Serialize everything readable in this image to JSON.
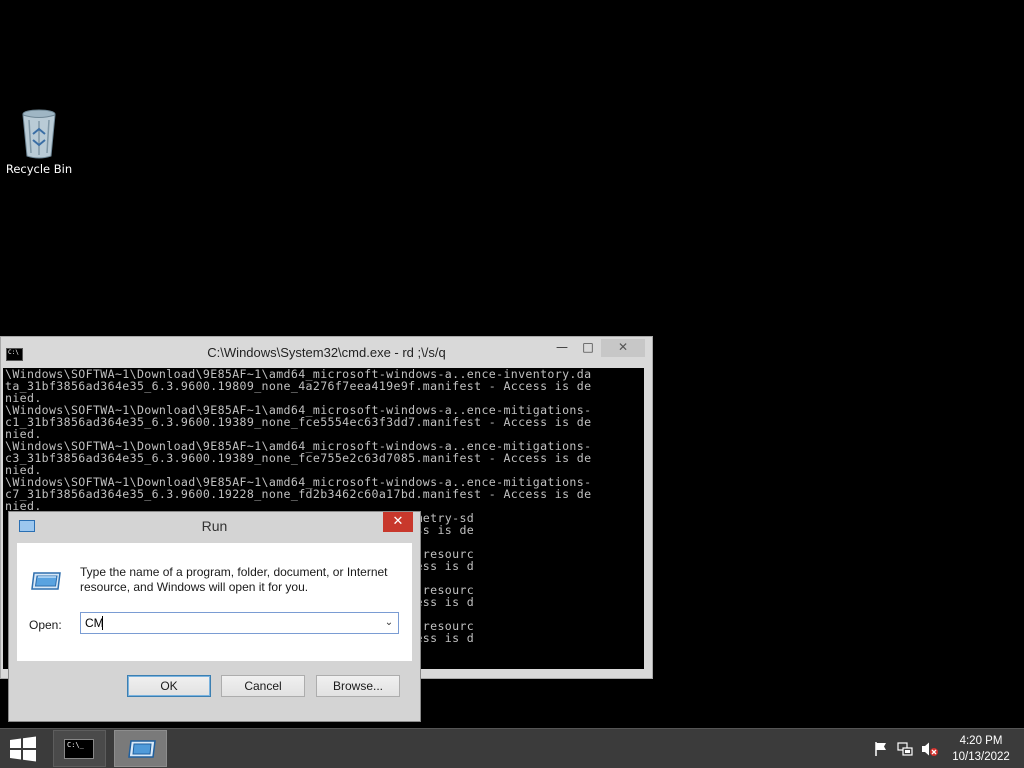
{
  "desktop": {
    "icons": [
      {
        "label": "Recycle Bin",
        "icon": "recycle-bin-icon"
      }
    ]
  },
  "cmd_window": {
    "title": "C:\\Windows\\System32\\cmd.exe - rd ;\\/s/q",
    "controls": {
      "minimize": "—",
      "maximize": "□",
      "close": "✕"
    },
    "lines": [
      "\\Windows\\SOFTWA~1\\Download\\9E85AF~1\\amd64_microsoft-windows-a..ence-inventory.da",
      "ta_31bf3856ad364e35_6.3.9600.19809_none_4a276f7eea419e9f.manifest - Access is de",
      "nied.",
      "\\Windows\\SOFTWA~1\\Download\\9E85AF~1\\amd64_microsoft-windows-a..ence-mitigations-",
      "c1_31bf3856ad364e35_6.3.9600.19389_none_fce5554ec63f3dd7.manifest - Access is de",
      "nied.",
      "\\Windows\\SOFTWA~1\\Download\\9E85AF~1\\amd64_microsoft-windows-a..ence-mitigations-",
      "c3_31bf3856ad364e35_6.3.9600.19389_none_fce755e2c63d7085.manifest - Access is de",
      "nied.",
      "\\Windows\\SOFTWA~1\\Download\\9E85AF~1\\amd64_microsoft-windows-a..ence-mitigations-",
      "c7_31bf3856ad364e35_6.3.9600.19228_none_fd2b3462c60a17bd.manifest - Access is de",
      "nied.",
      "                                    windows-a..ence-telemetry-sd",
      "                                    35e1.manifest - Access is de",
      "",
      "                                    windows-a..in-native.resourc",
      "                                    eedfd.manifest - Access is d",
      "",
      "                                    windows-a..in-native.resourc",
      "                                    4e9fc.manifest - Access is d",
      "",
      "                                    windows-a..in-native.resourc",
      "                                    b3e96.manifest - Access is d"
    ]
  },
  "run_dialog": {
    "title": "Run",
    "close_glyph": "✕",
    "description": "Type the name of a program, folder, document, or Internet resource, and Windows will open it for you.",
    "open_label": "Open:",
    "input_value": "CM",
    "dropdown_glyph": "⌄",
    "buttons": {
      "ok": "OK",
      "cancel": "Cancel",
      "browse": "Browse..."
    }
  },
  "taskbar": {
    "items": [
      {
        "name": "Command Prompt",
        "active": false
      },
      {
        "name": "Run",
        "active": true
      }
    ],
    "tray_icons": [
      "flag-icon",
      "network-icon",
      "volume-muted-icon"
    ],
    "clock": {
      "time": "4:20 PM",
      "date": "10/13/2022"
    }
  }
}
